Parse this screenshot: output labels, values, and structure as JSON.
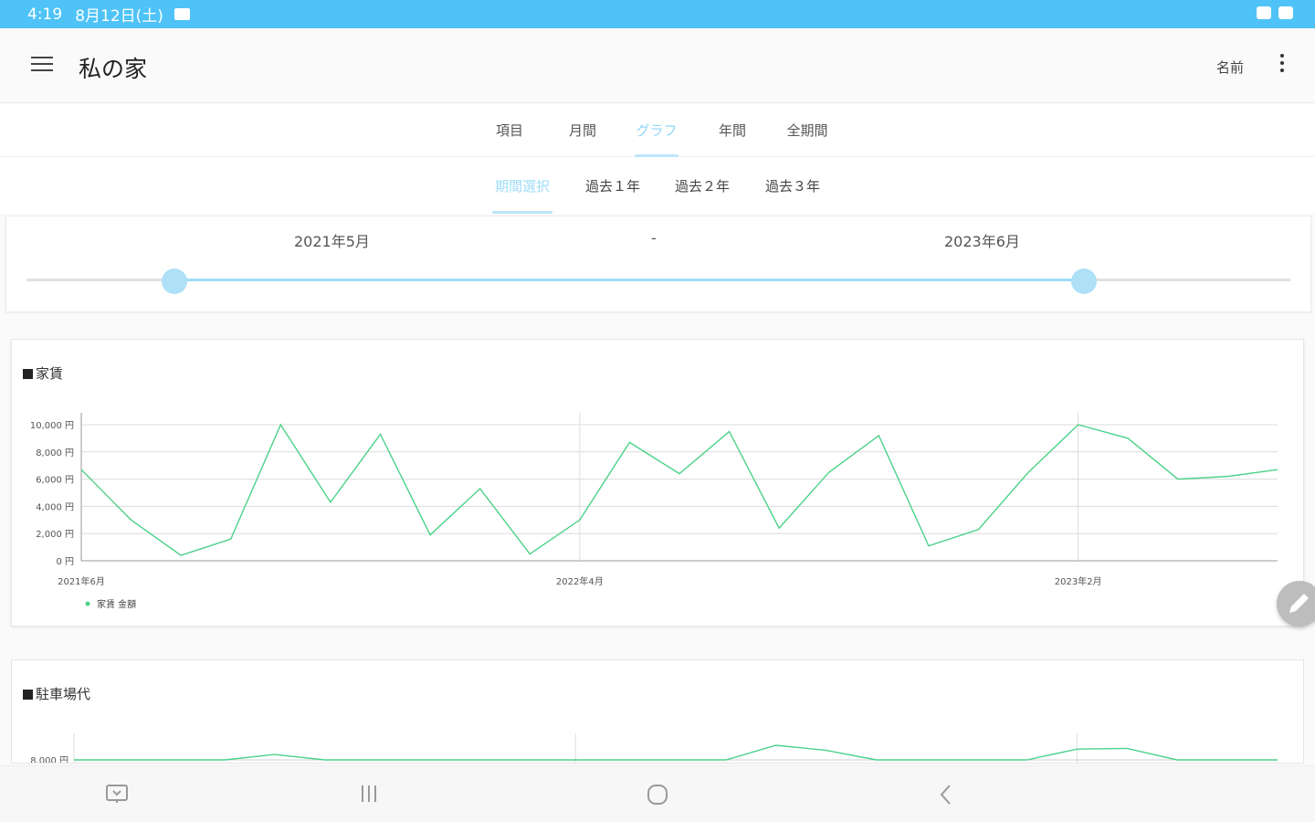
{
  "status_bar": {
    "time": "4:19",
    "date": "8月12日(土)"
  },
  "app_bar": {
    "title": "私の家",
    "name_label": "名前"
  },
  "tabs": [
    {
      "label": "項目",
      "active": false
    },
    {
      "label": "月間",
      "active": false
    },
    {
      "label": "グラフ",
      "active": true
    },
    {
      "label": "年間",
      "active": false
    },
    {
      "label": "全期間",
      "active": false
    }
  ],
  "subtabs": [
    {
      "label": "期間選択",
      "active": true
    },
    {
      "label": "過去１年",
      "active": false
    },
    {
      "label": "過去２年",
      "active": false
    },
    {
      "label": "過去３年",
      "active": false
    }
  ],
  "range": {
    "from_label": "2021年5月",
    "separator": "-",
    "to_label": "2023年6月",
    "from_fraction": 0.117,
    "to_fraction": 0.837
  },
  "colors": {
    "accent": "#4fc3f7",
    "series": "#4cd28a",
    "slider": "#9fdcf8"
  },
  "chart_data": [
    {
      "type": "line",
      "title": "家賃",
      "y_ticks": [
        "0 円",
        "2,000 円",
        "4,000 円",
        "6,000 円",
        "8,000 円",
        "10,000 円"
      ],
      "ylim": [
        0,
        10000
      ],
      "x_tick_labels": [
        "2021年6月",
        "2022年4月",
        "2023年2月"
      ],
      "x_tick_index": [
        0,
        10,
        20
      ],
      "series": [
        {
          "name": "家賃 金額",
          "values": [
            6700,
            3000,
            400,
            1600,
            10000,
            4300,
            9300,
            1900,
            5300,
            500,
            3000,
            8700,
            6400,
            9500,
            2400,
            6500,
            9200,
            1100,
            2300,
            6500,
            10000,
            9000,
            6000,
            6200,
            6700
          ]
        }
      ],
      "grid": true,
      "legend": "bottom-left"
    },
    {
      "type": "line",
      "title": "駐車場代",
      "y_ticks": [
        "8,000 円"
      ],
      "partial": true,
      "series": [
        {
          "name": "駐車場代",
          "values": [
            7200,
            7200,
            7200,
            7200,
            8050,
            7200,
            7200,
            7200,
            7200,
            7200,
            7200,
            7200,
            7200,
            7200,
            9500,
            8700,
            7200,
            7200,
            7200,
            7200,
            8900,
            9000,
            7200,
            7200,
            7200
          ]
        }
      ]
    }
  ]
}
